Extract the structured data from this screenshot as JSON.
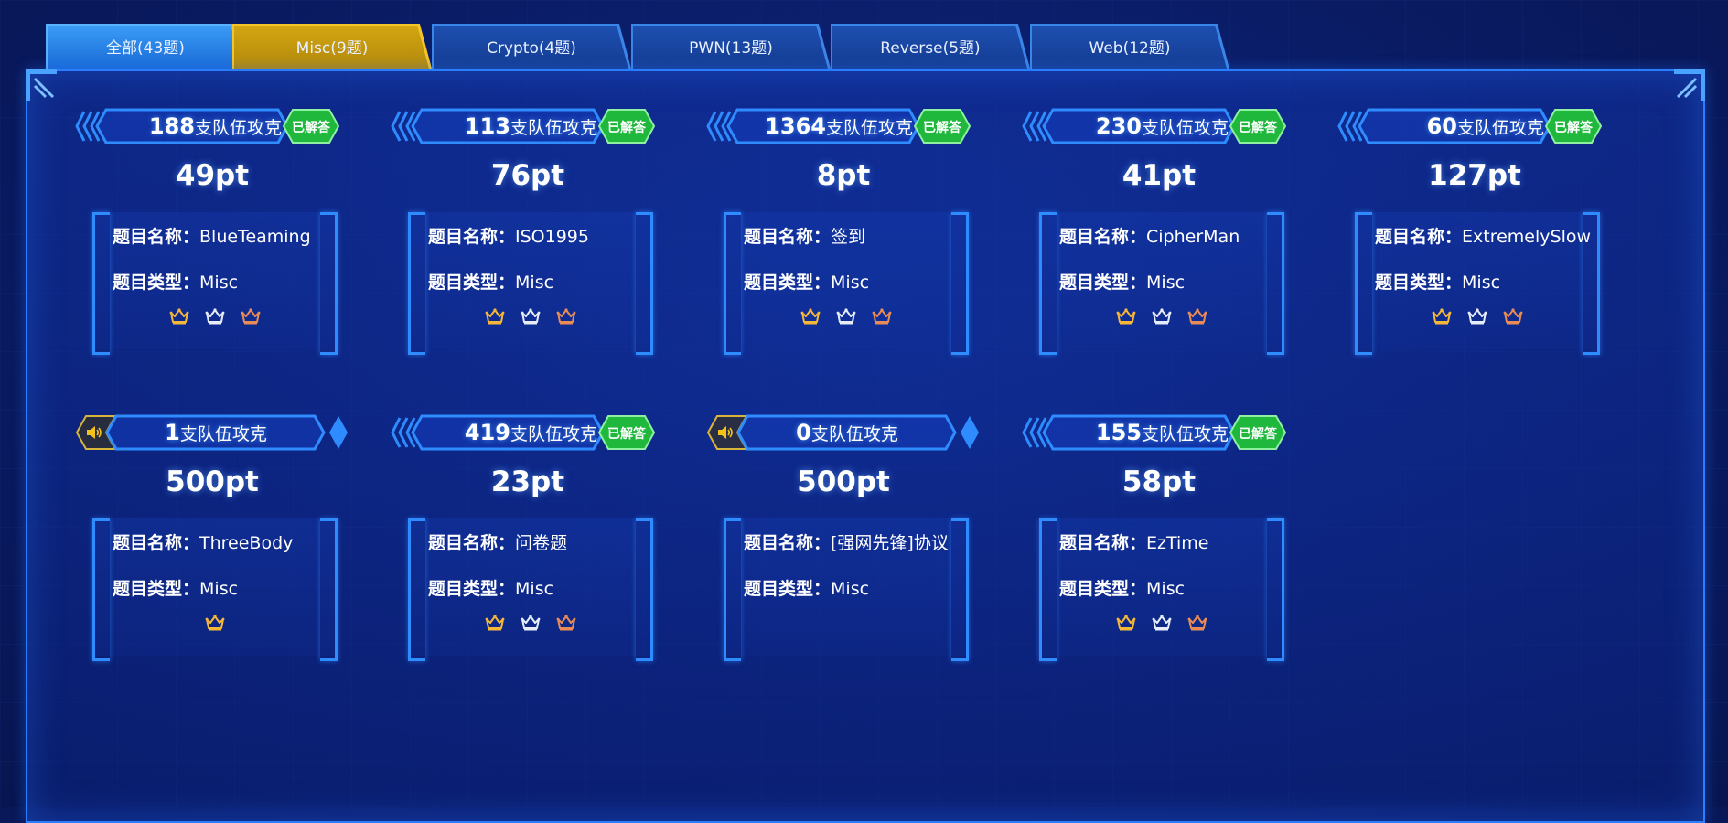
{
  "tabs": [
    {
      "label": "全部(43题)",
      "state": "all"
    },
    {
      "label": "Misc(9题)",
      "state": "active"
    },
    {
      "label": "Crypto(4题)",
      "state": "plain"
    },
    {
      "label": "PWN(13题)",
      "state": "plain"
    },
    {
      "label": "Reverse(5题)",
      "state": "plain"
    },
    {
      "label": "Web(12题)",
      "state": "plain"
    }
  ],
  "labels": {
    "name_key": "题目名称：",
    "type_key": "题目类型：",
    "teams_suffix": "支队伍攻克",
    "solved": "已解答"
  },
  "challenges": [
    {
      "teams": "188",
      "points": "49pt",
      "name": "BlueTeaming",
      "type": "Misc",
      "solved": true,
      "crowns": [
        "gold",
        "silver",
        "bronze"
      ]
    },
    {
      "teams": "113",
      "points": "76pt",
      "name": "ISO1995",
      "type": "Misc",
      "solved": true,
      "crowns": [
        "gold",
        "silver",
        "bronze"
      ]
    },
    {
      "teams": "1364",
      "points": "8pt",
      "name": "签到",
      "type": "Misc",
      "solved": true,
      "crowns": [
        "gold",
        "silver",
        "bronze"
      ]
    },
    {
      "teams": "230",
      "points": "41pt",
      "name": "CipherMan",
      "type": "Misc",
      "solved": true,
      "crowns": [
        "gold",
        "silver",
        "bronze"
      ]
    },
    {
      "teams": "60",
      "points": "127pt",
      "name": "ExtremelySlow",
      "type": "Misc",
      "solved": true,
      "crowns": [
        "gold",
        "silver",
        "bronze"
      ]
    },
    {
      "teams": "1",
      "points": "500pt",
      "name": "ThreeBody",
      "type": "Misc",
      "solved": false,
      "crowns": [
        "gold"
      ]
    },
    {
      "teams": "419",
      "points": "23pt",
      "name": "问卷题",
      "type": "Misc",
      "solved": true,
      "crowns": [
        "gold",
        "silver",
        "bronze"
      ]
    },
    {
      "teams": "0",
      "points": "500pt",
      "name": "[强网先锋]协议",
      "type": "Misc",
      "solved": false,
      "crowns": []
    },
    {
      "teams": "155",
      "points": "58pt",
      "name": "EzTime",
      "type": "Misc",
      "solved": true,
      "crowns": [
        "gold",
        "silver",
        "bronze"
      ]
    }
  ],
  "colors": {
    "gold": "#f5b73a",
    "silver": "#e6ecf8",
    "bronze": "#e88b56",
    "solved_green": "#1fb83c",
    "accent_blue": "#2f8cff",
    "active_tab": "#c99a10"
  }
}
